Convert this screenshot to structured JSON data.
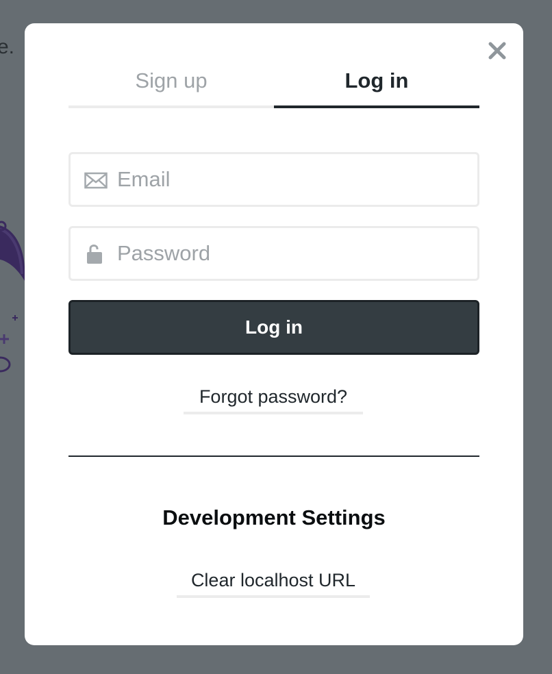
{
  "backdrop": {
    "partial_text": "e."
  },
  "modal": {
    "tabs": [
      {
        "label": "Sign up",
        "active": false
      },
      {
        "label": "Log in",
        "active": true
      }
    ],
    "email": {
      "placeholder": "Email",
      "value": "",
      "icon": "envelope-icon"
    },
    "password": {
      "placeholder": "Password",
      "value": "",
      "icon": "lock-icon"
    },
    "login_button": "Log in",
    "forgot_password": "Forgot password?",
    "dev_settings": {
      "heading": "Development Settings",
      "clear_url": "Clear localhost URL"
    },
    "close_icon": "close-icon"
  },
  "colors": {
    "overlay": "#666d72",
    "primary_button": "#343d42",
    "text_dark": "#20272c",
    "text_muted": "#9ea3a7"
  }
}
